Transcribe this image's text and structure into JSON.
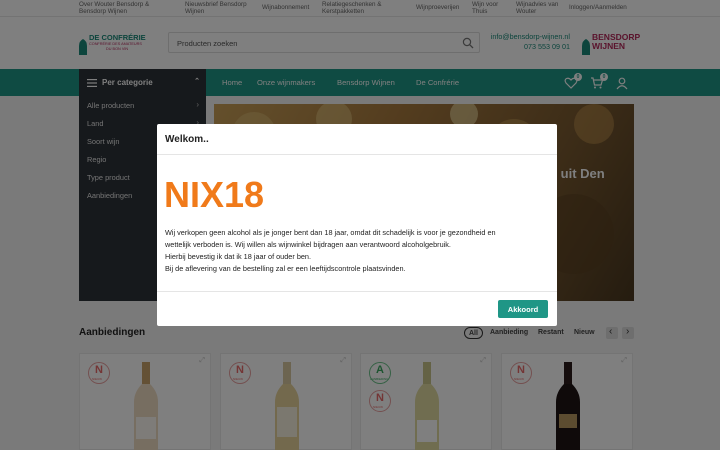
{
  "topbar": {
    "links": [
      "Over Wouter Bensdorp &",
      "Bensdorp Wijnen",
      "Nieuwsbrief Bensdorp",
      "Wijnen",
      "Wijnabonnement",
      "Relatiegeschenken &",
      "Kerstpakketten",
      "Wijnproeverijen",
      "Wijn voor",
      "Thuis",
      "Wijnadvies van",
      "Wouter",
      "Inloggen/Aanmelden"
    ]
  },
  "header": {
    "logo_left_title": "DE CONFRÉRIE",
    "logo_left_sub1": "CONFRÉRIE DES AMATEURS",
    "logo_left_sub2": "DU BON VIN",
    "logo_right_l1": "BENSDORP",
    "logo_right_l2": "WIJNEN",
    "search_placeholder": "Producten zoeken",
    "email": "info@bensdorp-wijnen.nl",
    "phone": "073 553 09 01"
  },
  "nav": {
    "category_label": "Per categorie",
    "items": [
      "Home",
      "Onze wijnmakers",
      "Bensdorp Wijnen",
      "De Confrérie"
    ],
    "wishlist_count": "0",
    "cart_count": "0"
  },
  "sidebar": {
    "items": [
      "Alle producten",
      "Land",
      "Soort wijn",
      "Regio",
      "Type product",
      "Aanbiedingen"
    ]
  },
  "hero": {
    "text": "r uit Den"
  },
  "section": {
    "title": "Aanbiedingen",
    "tabs": [
      "All",
      "Aanbieding",
      "Restant",
      "Nieuw"
    ]
  },
  "cards": {
    "badge_letters": [
      "N",
      "N",
      "A",
      "N",
      "N"
    ],
    "badge_words": [
      "NIEUW",
      "NIEUW",
      "AANBIEDING",
      "NIEUW",
      "NIEUW"
    ]
  },
  "modal": {
    "title": "Welkom..",
    "logo_text": "NIX18",
    "lines": [
      "Wij verkopen geen alcohol als je jonger bent dan 18 jaar, omdat dit schadelijk is voor je gezondheid en",
      "wettelijk verboden is. Wij willen als wijnwinkel bijdragen aan verantwoord alcoholgebruik.",
      "Hierbij bevestig ik dat ik 18 jaar of ouder ben.",
      "Bij de aflevering van de bestelling zal er een leeftijdscontrole plaatsvinden."
    ],
    "accept_label": "Akkoord"
  },
  "colors": {
    "accent": "#1f9686",
    "dark": "#2d3238",
    "logo_green": "#1a8a7a",
    "logo_pink": "#b5285b",
    "nix_orange": "#f07a1a"
  }
}
